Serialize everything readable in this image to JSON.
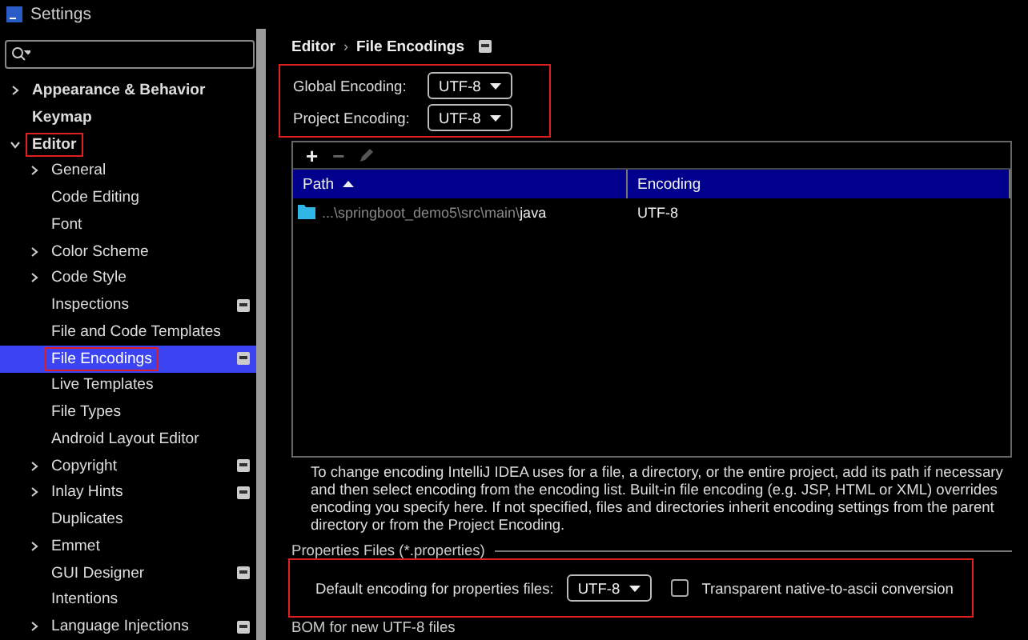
{
  "window": {
    "title": "Settings"
  },
  "sidebar": {
    "items": [
      {
        "label": "Appearance & Behavior",
        "bold": true,
        "expanded": false,
        "selected": false,
        "highlighted": false
      },
      {
        "label": "Keymap",
        "bold": true,
        "selected": false,
        "highlighted": false
      },
      {
        "label": "Editor",
        "bold": true,
        "expanded": true,
        "selected": false,
        "highlighted": true,
        "children": [
          {
            "label": "General",
            "expanded": false,
            "selected": false,
            "highlighted": false
          },
          {
            "label": "Code Editing",
            "selected": false,
            "highlighted": false
          },
          {
            "label": "Font",
            "selected": false,
            "highlighted": false
          },
          {
            "label": "Color Scheme",
            "expanded": false,
            "selected": false,
            "highlighted": false
          },
          {
            "label": "Code Style",
            "expanded": false,
            "selected": false,
            "highlighted": false
          },
          {
            "label": "Inspections",
            "project": true,
            "selected": false,
            "highlighted": false
          },
          {
            "label": "File and Code Templates",
            "selected": false,
            "highlighted": false
          },
          {
            "label": "File Encodings",
            "project": true,
            "selected": true,
            "highlighted": true
          },
          {
            "label": "Live Templates",
            "selected": false,
            "highlighted": false
          },
          {
            "label": "File Types",
            "selected": false,
            "highlighted": false
          },
          {
            "label": "Android Layout Editor",
            "selected": false,
            "highlighted": false
          },
          {
            "label": "Copyright",
            "expanded": false,
            "project": true,
            "selected": false,
            "highlighted": false
          },
          {
            "label": "Inlay Hints",
            "expanded": false,
            "project": true,
            "selected": false,
            "highlighted": false
          },
          {
            "label": "Duplicates",
            "selected": false,
            "highlighted": false
          },
          {
            "label": "Emmet",
            "expanded": false,
            "selected": false,
            "highlighted": false
          },
          {
            "label": "GUI Designer",
            "project": true,
            "selected": false,
            "highlighted": false
          },
          {
            "label": "Intentions",
            "selected": false,
            "highlighted": false
          },
          {
            "label": "Language Injections",
            "expanded": false,
            "project": true,
            "selected": false,
            "highlighted": false
          }
        ]
      }
    ]
  },
  "breadcrumb": {
    "parent": "Editor",
    "separator": "›",
    "current": "File Encodings"
  },
  "encodings": {
    "highlighted": true,
    "fields": [
      {
        "label": "Global Encoding:",
        "value": "UTF-8"
      },
      {
        "label": "Project Encoding:",
        "value": "UTF-8"
      }
    ]
  },
  "table": {
    "toolbar": {
      "add": "+",
      "remove": "−",
      "edit_disabled": true
    },
    "columns": [
      {
        "label": "Path",
        "sort_ascending": true
      },
      {
        "label": "Encoding"
      }
    ],
    "rows": [
      {
        "path_prefix": "...\\springboot_demo5\\src\\main\\",
        "path_name": "java",
        "encoding": "UTF-8"
      }
    ]
  },
  "description": "To change encoding IntelliJ IDEA uses for a file, a directory, or the entire project, add its path if necessary and then select encoding from the encoding list. Built-in file encoding (e.g. JSP, HTML or XML) overrides encoding you specify here. If not specified, files and directories inherit encoding settings from the parent directory or from the Project Encoding.",
  "properties": {
    "title": "Properties Files (*.properties)",
    "highlighted": true,
    "label": "Default encoding for properties files:",
    "value": "UTF-8",
    "checkbox": {
      "label": "Transparent native-to-ascii conversion",
      "checked": false
    }
  },
  "bom_title": "BOM for new UTF-8 files"
}
